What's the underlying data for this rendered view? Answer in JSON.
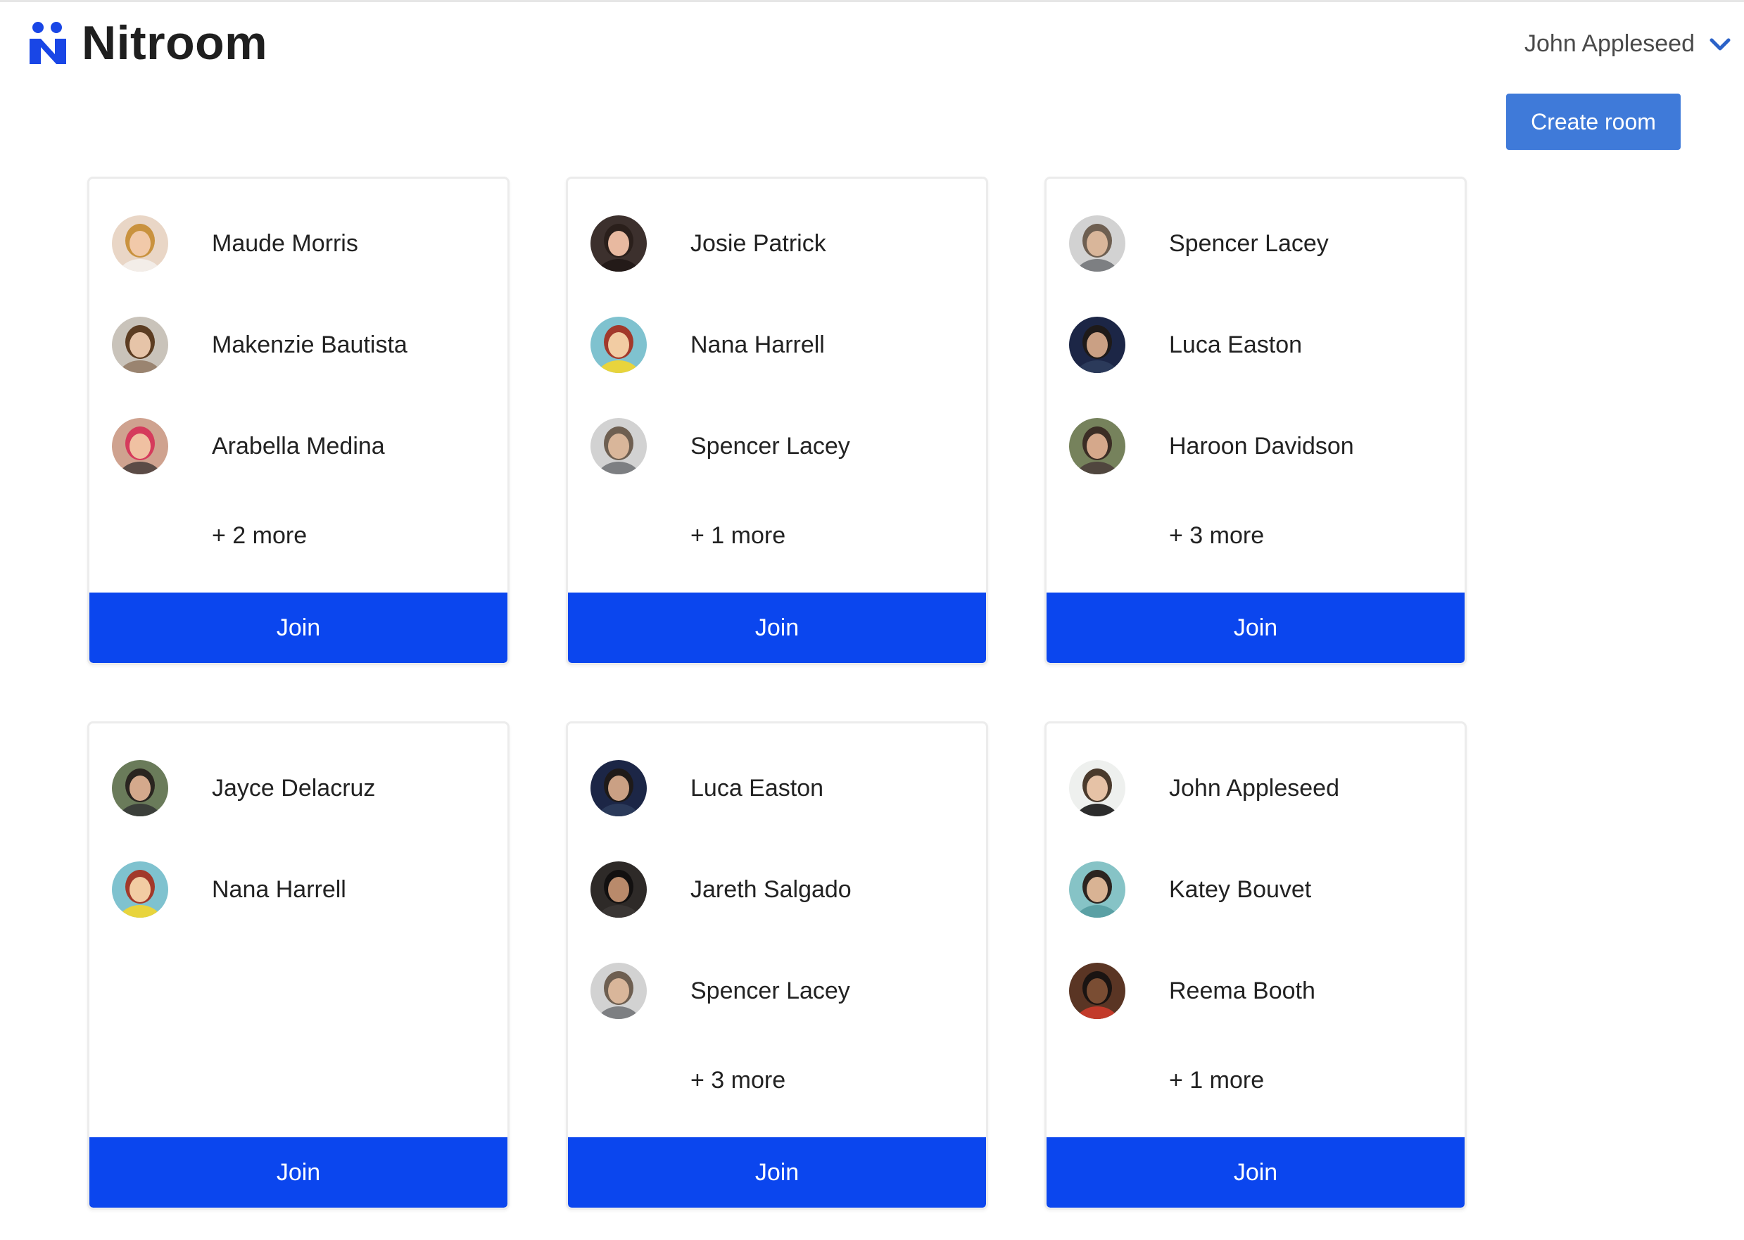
{
  "app": {
    "name": "Nitroom"
  },
  "header": {
    "user_name": "John Appleseed",
    "create_room_label": "Create room"
  },
  "colors": {
    "brand": "#1946e6",
    "primary_button": "#3f7ad9",
    "join_button": "#0b46ee"
  },
  "rooms": [
    {
      "members": [
        {
          "name": "Maude Morris",
          "avatar": {
            "bg": "#e9d6c6",
            "hair": "#c9923e",
            "skin": "#f1c9a9",
            "shirt": "#f3ede8"
          }
        },
        {
          "name": "Makenzie Bautista",
          "avatar": {
            "bg": "#c9c3ba",
            "hair": "#5c3d22",
            "skin": "#e6c4a8",
            "shirt": "#9a8470"
          }
        },
        {
          "name": "Arabella Medina",
          "avatar": {
            "bg": "#cfa28f",
            "hair": "#d53b5c",
            "skin": "#f0c1a2",
            "shirt": "#5b4b46"
          }
        }
      ],
      "more": "+ 2 more",
      "join_label": "Join"
    },
    {
      "members": [
        {
          "name": "Josie Patrick",
          "avatar": {
            "bg": "#3c302d",
            "hair": "#2a1f1b",
            "skin": "#e8b9a0",
            "shirt": "#231a18"
          }
        },
        {
          "name": "Nana Harrell",
          "avatar": {
            "bg": "#7fc2cf",
            "hair": "#a2392b",
            "skin": "#f2cca3",
            "shirt": "#e8d43c"
          }
        },
        {
          "name": "Spencer Lacey",
          "avatar": {
            "bg": "#d2d2d2",
            "hair": "#6e5f51",
            "skin": "#d9b69a",
            "shirt": "#7d7f82"
          }
        }
      ],
      "more": "+ 1 more",
      "join_label": "Join"
    },
    {
      "members": [
        {
          "name": "Spencer Lacey",
          "avatar": {
            "bg": "#d2d2d2",
            "hair": "#6e5f51",
            "skin": "#d9b69a",
            "shirt": "#7d7f82"
          }
        },
        {
          "name": "Luca Easton",
          "avatar": {
            "bg": "#1c2646",
            "hair": "#1e1a19",
            "skin": "#caa084",
            "shirt": "#2b3a5a"
          }
        },
        {
          "name": "Haroon Davidson",
          "avatar": {
            "bg": "#76825c",
            "hair": "#3b2d25",
            "skin": "#d5a88b",
            "shirt": "#50463e"
          }
        }
      ],
      "more": "+ 3 more",
      "join_label": "Join"
    },
    {
      "members": [
        {
          "name": "Jayce Delacruz",
          "avatar": {
            "bg": "#6a7b5a",
            "hair": "#2a2520",
            "skin": "#d4a98c",
            "shirt": "#3b3f3a"
          }
        },
        {
          "name": "Nana Harrell",
          "avatar": {
            "bg": "#7fc2cf",
            "hair": "#a2392b",
            "skin": "#f2cca3",
            "shirt": "#e8d43c"
          }
        }
      ],
      "more": "",
      "join_label": "Join"
    },
    {
      "members": [
        {
          "name": "Luca Easton",
          "avatar": {
            "bg": "#1c2646",
            "hair": "#1e1a19",
            "skin": "#caa084",
            "shirt": "#2b3a5a"
          }
        },
        {
          "name": "Jareth Salgado",
          "avatar": {
            "bg": "#2e2a28",
            "hair": "#121010",
            "skin": "#b98a6b",
            "shirt": "#3a3634"
          }
        },
        {
          "name": "Spencer Lacey",
          "avatar": {
            "bg": "#d2d2d2",
            "hair": "#6e5f51",
            "skin": "#d9b69a",
            "shirt": "#7d7f82"
          }
        }
      ],
      "more": "+ 3 more",
      "join_label": "Join"
    },
    {
      "members": [
        {
          "name": "John Appleseed",
          "avatar": {
            "bg": "#eef0ee",
            "hair": "#4a3a2c",
            "skin": "#e6c2a6",
            "shirt": "#2c2c2c"
          }
        },
        {
          "name": "Katey Bouvet",
          "avatar": {
            "bg": "#86c3c6",
            "hair": "#2c2420",
            "skin": "#d9b394",
            "shirt": "#5aa0a4"
          }
        },
        {
          "name": "Reema Booth",
          "avatar": {
            "bg": "#5a3524",
            "hair": "#1a1412",
            "skin": "#7a4d33",
            "shirt": "#c23a2a"
          }
        }
      ],
      "more": "+ 1 more",
      "join_label": "Join"
    }
  ]
}
